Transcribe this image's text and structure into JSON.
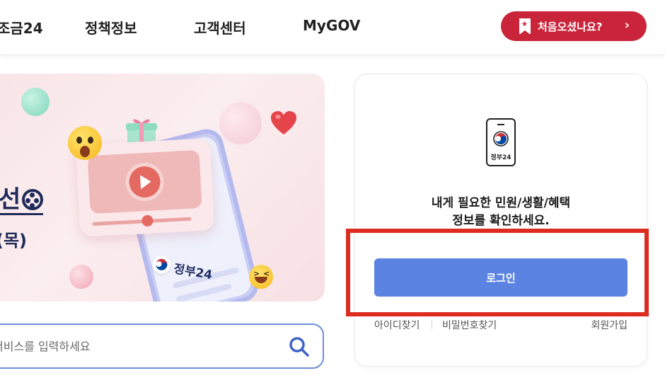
{
  "nav": {
    "items": [
      "조금24",
      "정책정보",
      "고객센터",
      "MyGOV"
    ],
    "first_visit": {
      "label": "처음오셨나요?",
      "chevron": "›",
      "icon": "bookmark-star-icon"
    }
  },
  "banner": {
    "title": "선",
    "date": "(목)",
    "brand": "정부24"
  },
  "search": {
    "placeholder": "서비스를 입력하세요",
    "icon": "search-icon"
  },
  "login_card": {
    "icon_caption": "정부24",
    "message_line1": "내게 필요한 민원/생활/혜택",
    "message_line2": "정보를 확인하세요.",
    "login_label": "로그인",
    "links": {
      "find_id": "아이디찾기",
      "find_password": "비밀번호찾기",
      "signup": "회원가입"
    }
  },
  "colors": {
    "brand_red": "#c9243a",
    "login_blue": "#5b84e2",
    "search_border": "#6d8ed8",
    "highlight_red": "#dc2c20",
    "banner_navy": "#1e2a58"
  }
}
